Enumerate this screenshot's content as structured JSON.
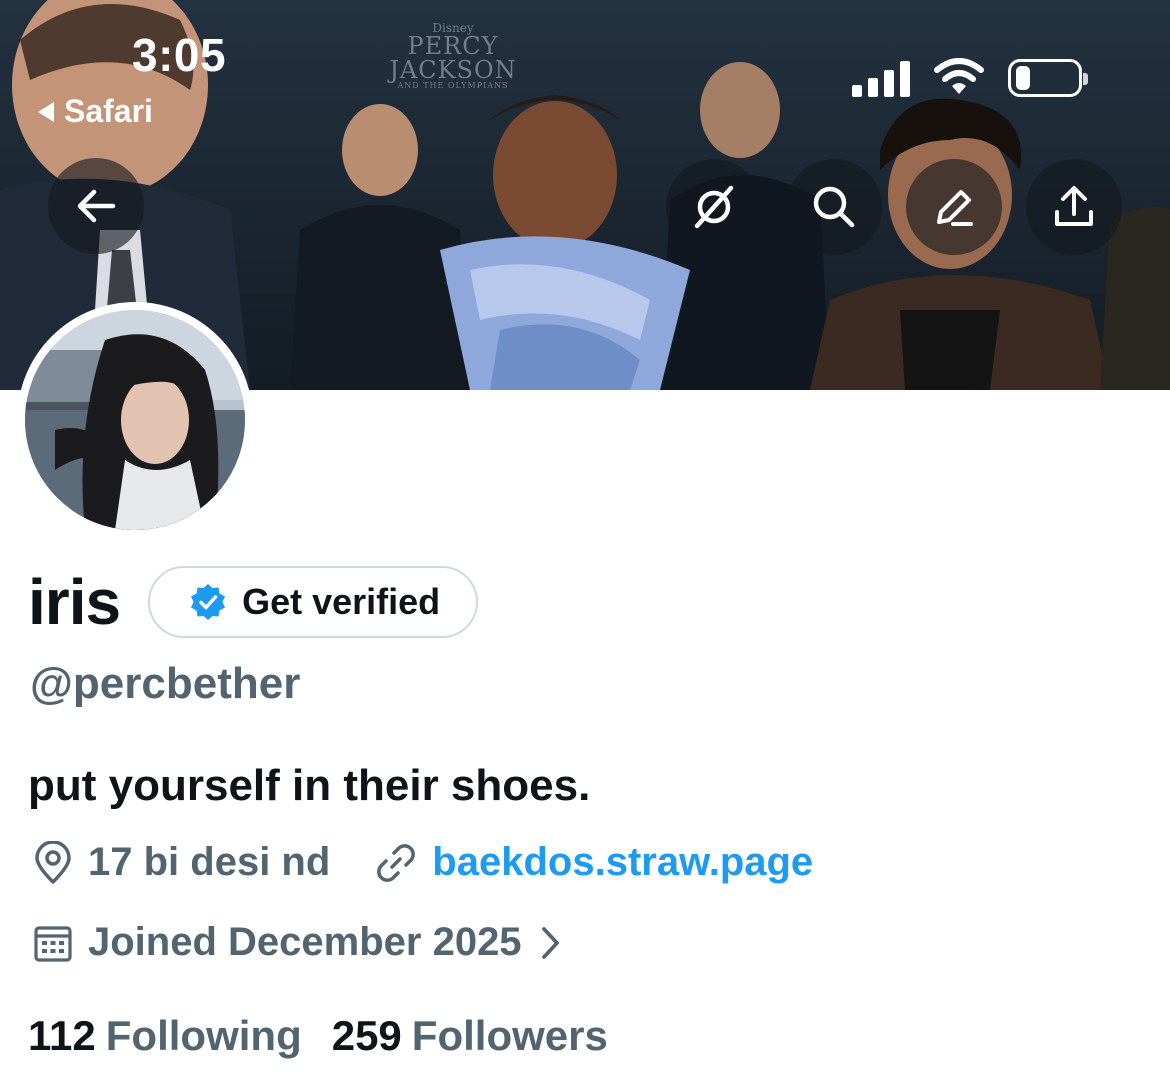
{
  "status_bar": {
    "time": "3:05",
    "back_app": "Safari"
  },
  "banner": {
    "logo_small": "Disney",
    "logo_line1": "PERCY",
    "logo_line2": "JACKSON",
    "logo_line3": "AND THE OLYMPIANS"
  },
  "nav": {
    "back": "arrow-left-icon",
    "grok": "slash-circle-icon",
    "search": "search-icon",
    "edit": "pencil-icon",
    "share": "share-icon"
  },
  "profile": {
    "display_name": "iris",
    "verify_label": "Get verified",
    "handle": "@percbether",
    "bio": "put yourself in their shoes.",
    "location": "17 bi desi nd",
    "website": "baekdos.straw.page",
    "joined": "Joined December 2025",
    "following_count": "112",
    "following_label": "Following",
    "followers_count": "259",
    "followers_label": "Followers"
  },
  "colors": {
    "accent": "#1d9bf0",
    "secondary_text": "#536471",
    "primary_text": "#0f1419"
  }
}
